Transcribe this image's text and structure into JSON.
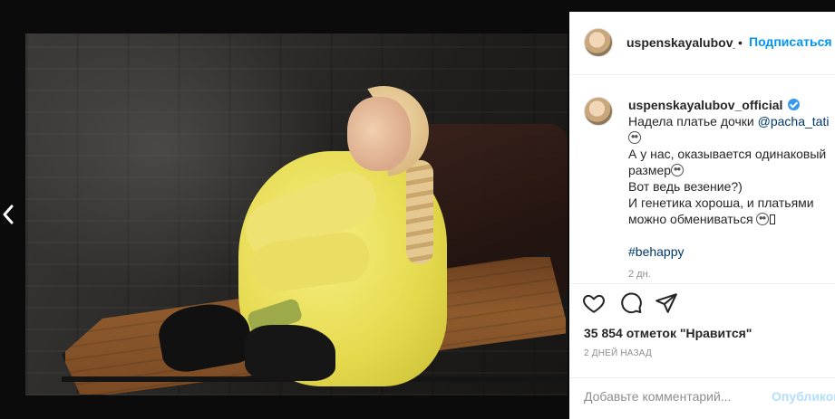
{
  "post": {
    "username": "uspenskayalubov_official",
    "username_truncated": "uspenskayalubov_c",
    "header_separator": "•",
    "follow_label": "Подписаться",
    "caption": {
      "username": "uspenskayalubov_official",
      "line1": "Надела платье дочки ",
      "mention": "@pacha_tati",
      "line2": "А у нас, оказывается одинаковый размер",
      "line3": "Вот ведь везение?)",
      "line4": "И генетика хороша, и платьями можно обмениваться",
      "hashtag": "#behappy"
    },
    "caption_time": "2 дн.",
    "likes": "35 854 отметок \"Нравится\"",
    "date": "2 ДНЕЙ НАЗАД",
    "comment_placeholder": "Добавьте комментарий...",
    "post_label": "Опубликовать"
  },
  "icons": {
    "prev": "chevron-left-icon",
    "like": "heart-icon",
    "comment": "comment-icon",
    "share": "paper-plane-icon",
    "verified": "verified-badge-icon"
  },
  "colors": {
    "link_blue": "#0095f6",
    "verified_blue": "#3897f0",
    "text": "#262626",
    "muted": "#8e8e8e",
    "post_disabled": "#b2dffc",
    "mention": "#00376b"
  }
}
